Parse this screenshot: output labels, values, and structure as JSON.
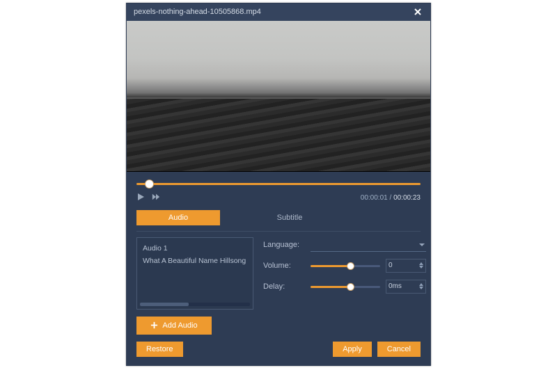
{
  "titlebar": {
    "filename": "pexels-nothing-ahead-10505868.mp4"
  },
  "player": {
    "currentTime": "00:00:01",
    "duration": "00:00:23",
    "seekPercent": 3
  },
  "tabs": {
    "audio": "Audio",
    "subtitle": "Subtitle",
    "active": "audio"
  },
  "audio": {
    "tracks": [
      "Audio 1",
      "What A Beautiful Name  Hillsong"
    ],
    "labels": {
      "language": "Language:",
      "volume": "Volume:",
      "delay": "Delay:"
    },
    "languageValue": "",
    "volumeValue": "0",
    "volumePercent": 54,
    "delayValue": "0ms",
    "delayPercent": 54,
    "addLabel": "Add Audio"
  },
  "footer": {
    "restore": "Restore",
    "apply": "Apply",
    "cancel": "Cancel"
  },
  "colors": {
    "accent": "#ee9a2f",
    "panel": "#2e3c54",
    "panelLight": "#35445e",
    "border": "#4a5a74",
    "text": "#c5ced9"
  }
}
